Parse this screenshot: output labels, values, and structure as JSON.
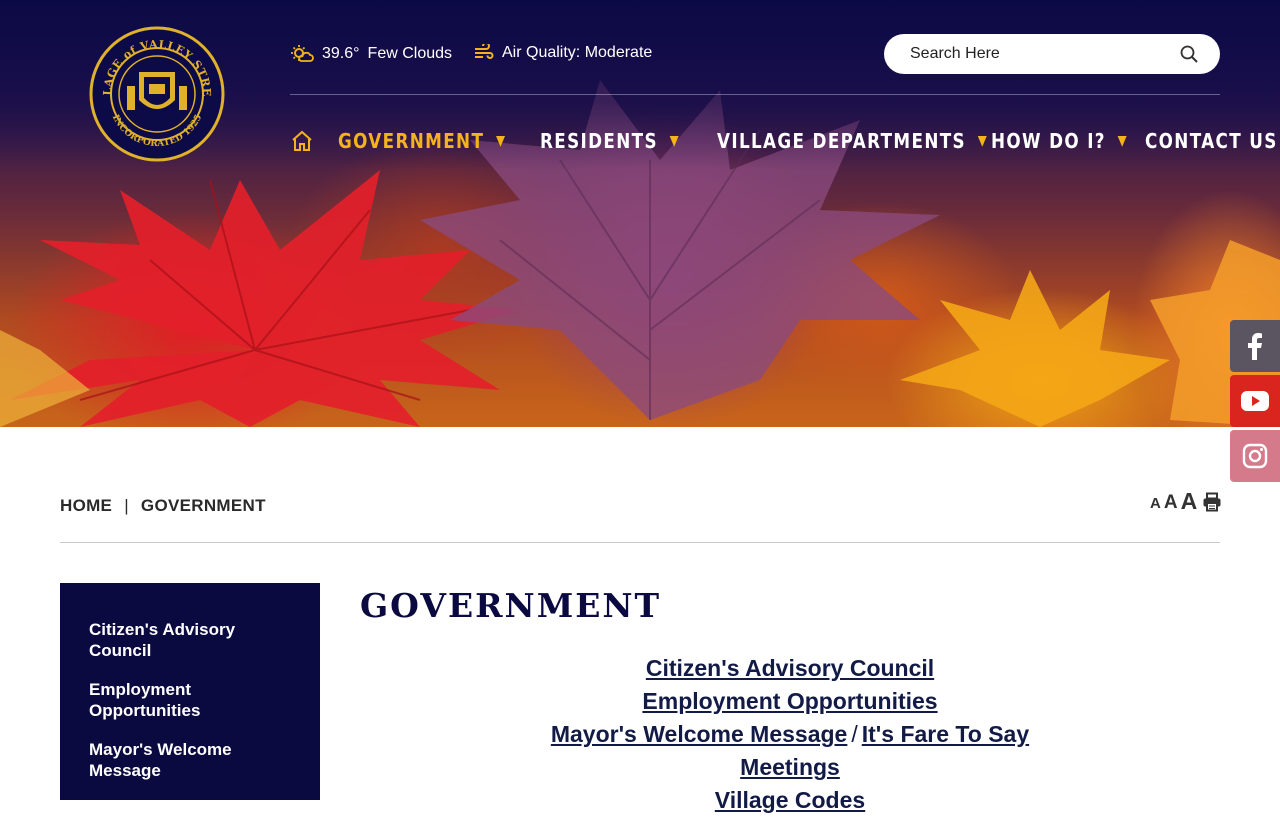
{
  "header": {
    "logo": {
      "text_top": "VILLAGE of VALLEY STREAM",
      "text_bottom": "INCORPORATED 1925",
      "icon": "village-seal"
    },
    "weather": {
      "icon": "partly-cloudy-icon",
      "temp": "39.6°",
      "condition": "Few Clouds"
    },
    "air_quality": {
      "icon": "wind-icon",
      "label": "Air Quality: Moderate"
    },
    "search": {
      "placeholder": "Search Here",
      "icon": "search-icon"
    },
    "nav": {
      "home_icon": "home-icon",
      "items": [
        {
          "label": "GOVERNMENT",
          "active": true,
          "dropdown": true
        },
        {
          "label": "RESIDENTS",
          "active": false,
          "dropdown": true
        },
        {
          "label": "VILLAGE DEPARTMENTS",
          "active": false,
          "dropdown": true
        },
        {
          "label": "HOW DO I?",
          "active": false,
          "dropdown": true
        },
        {
          "label": "CONTACT US",
          "active": false,
          "dropdown": false
        }
      ],
      "caret": "▼"
    },
    "colors": {
      "navy": "#0a0940",
      "accent": "#f5b21a"
    }
  },
  "social": [
    {
      "name": "facebook-icon",
      "color": "#5b5561"
    },
    {
      "name": "youtube-icon",
      "color": "#d9251d"
    },
    {
      "name": "instagram-icon",
      "color": "#d47a8a"
    }
  ],
  "breadcrumb": {
    "home": "HOME",
    "separator": "|",
    "current": "GOVERNMENT"
  },
  "text_tools": {
    "small": "A",
    "medium": "A",
    "large": "A",
    "print_icon": "print-icon"
  },
  "sidebar": {
    "items": [
      "Citizen's Advisory Council",
      "Employment Opportunities",
      "Mayor's Welcome Message"
    ]
  },
  "main": {
    "title": "GOVERNMENT",
    "links": [
      [
        "Citizen's Advisory Council"
      ],
      [
        "Employment Opportunities"
      ],
      [
        "Mayor's Welcome Message",
        "It's Fare To Say"
      ],
      [
        "Meetings"
      ],
      [
        "Village Codes"
      ]
    ],
    "link_separator": "/"
  }
}
